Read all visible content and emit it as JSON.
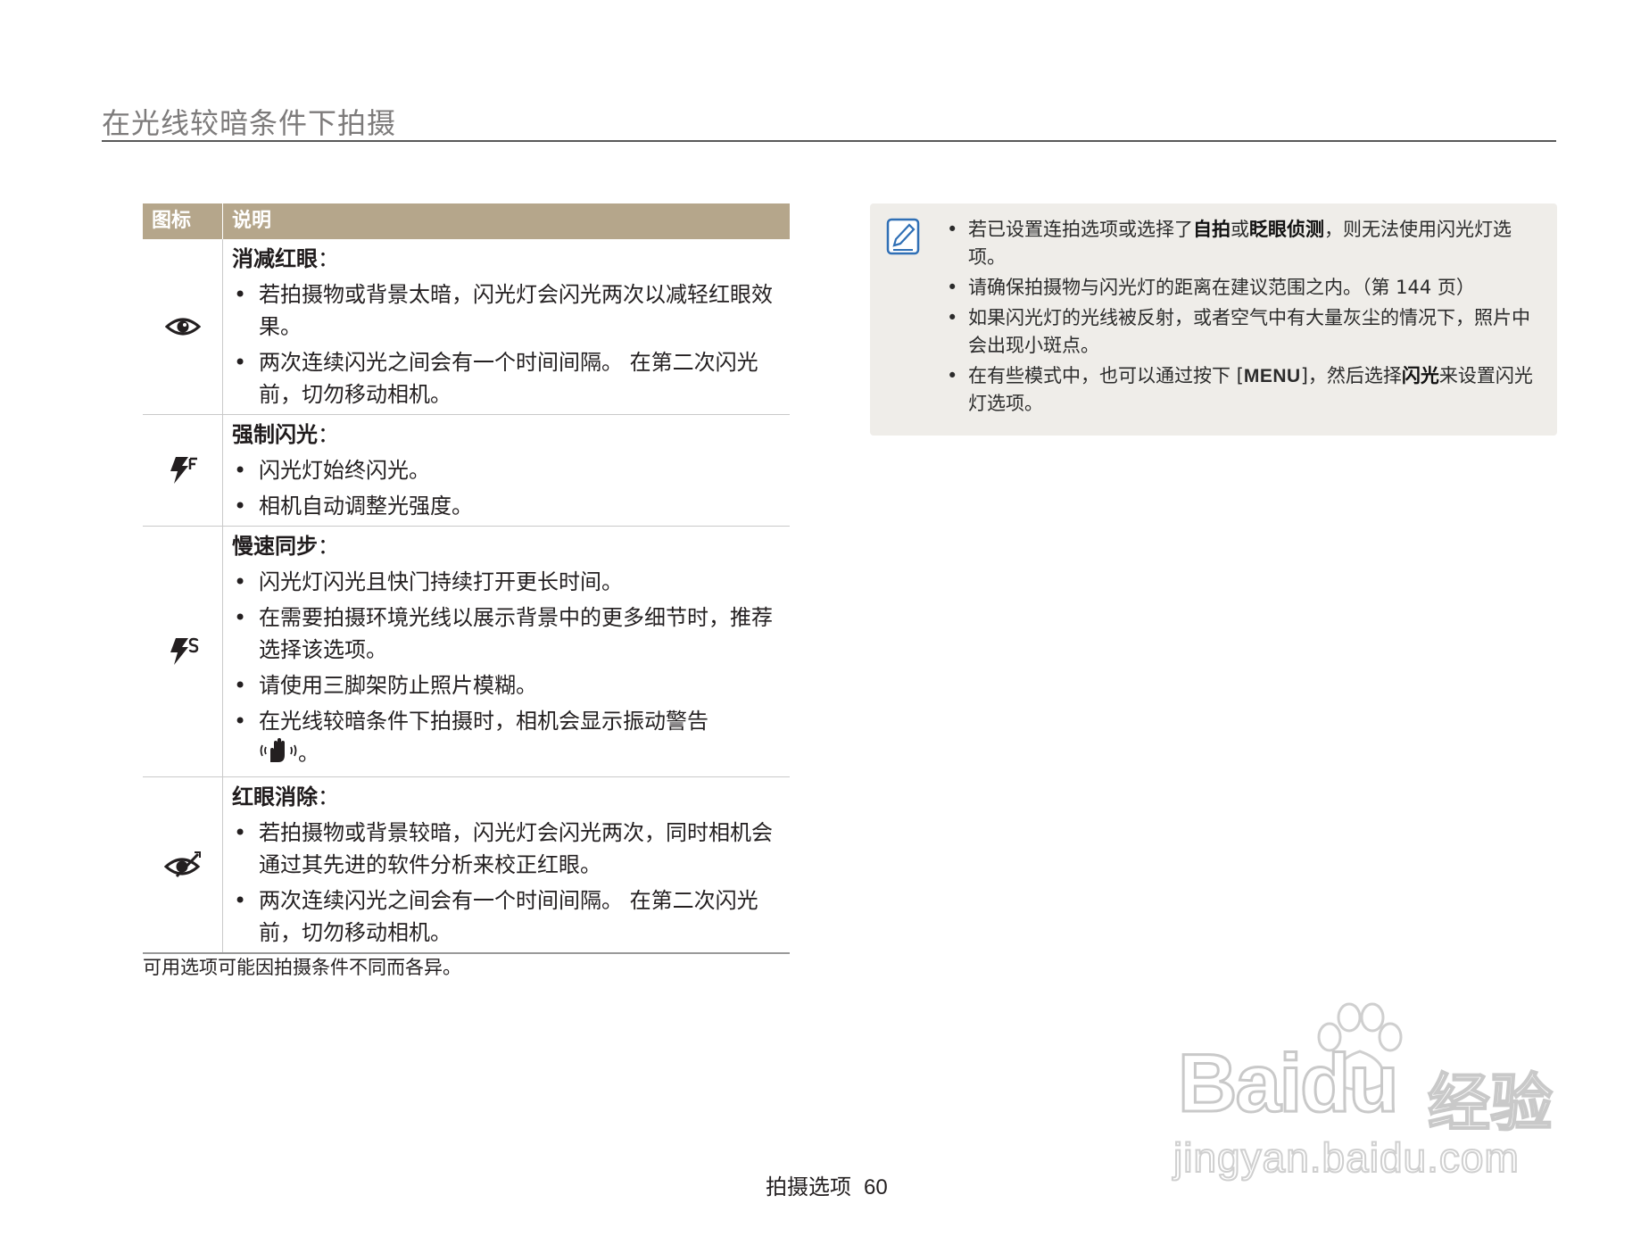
{
  "page_title": "在光线较暗条件下拍摄",
  "table": {
    "header_icon": "图标",
    "header_desc": "说明",
    "rows": [
      {
        "icon": "red-eye-reduction-icon",
        "title": "消减红眼",
        "colon": "：",
        "bullets": [
          "若拍摄物或背景太暗，闪光灯会闪光两次以减轻红眼效果。",
          "两次连续闪光之间会有一个时间间隔。 在第二次闪光前，切勿移动相机。"
        ]
      },
      {
        "icon": "fill-in-flash-icon",
        "title": "强制闪光",
        "colon": "：",
        "bullets": [
          "闪光灯始终闪光。",
          "相机自动调整光强度。"
        ]
      },
      {
        "icon": "slow-sync-icon",
        "title": "慢速同步",
        "colon": "：",
        "bullets": [
          "闪光灯闪光且快门持续打开更长时间。",
          "在需要拍摄环境光线以展示背景中的更多细节时，推荐选择该选项。",
          "请使用三脚架防止照片模糊。",
          "在光线较暗条件下拍摄时，相机会显示振动警告",
          "。"
        ]
      },
      {
        "icon": "red-eye-fix-icon",
        "title": "红眼消除",
        "colon": "：",
        "bullets": [
          "若拍摄物或背景较暗，闪光灯会闪光两次，同时相机会通过其先进的软件分析来校正红眼。",
          "两次连续闪光之间会有一个时间间隔。 在第二次闪光前，切勿移动相机。"
        ]
      }
    ]
  },
  "footnote": "可用选项可能因拍摄条件不同而各异。",
  "note": {
    "icon": "note-pencil-icon",
    "items": [
      {
        "pre": "若已设置连拍选项或选择了",
        "b1": "自拍",
        "mid": "或",
        "b2": "眨眼侦测",
        "post": "，则无法使用闪光灯选项。"
      },
      {
        "text": "请确保拍摄物与闪光灯的距离在建议范围之内。（第 144 页）"
      },
      {
        "text": "如果闪光灯的光线被反射，或者空气中有大量灰尘的情况下，照片中会出现小斑点。"
      },
      {
        "pre": "在有些模式中，也可以通过按下 [",
        "key": "MENU",
        "mid": "]，然后选择",
        "b1": "闪光",
        "post": "来设置闪光灯选项。"
      }
    ]
  },
  "footer": {
    "section": "拍摄选项",
    "page": "60"
  },
  "watermark": {
    "main": "Baidu",
    "cn": "经验",
    "sub": "jingyan.baidu.com"
  }
}
